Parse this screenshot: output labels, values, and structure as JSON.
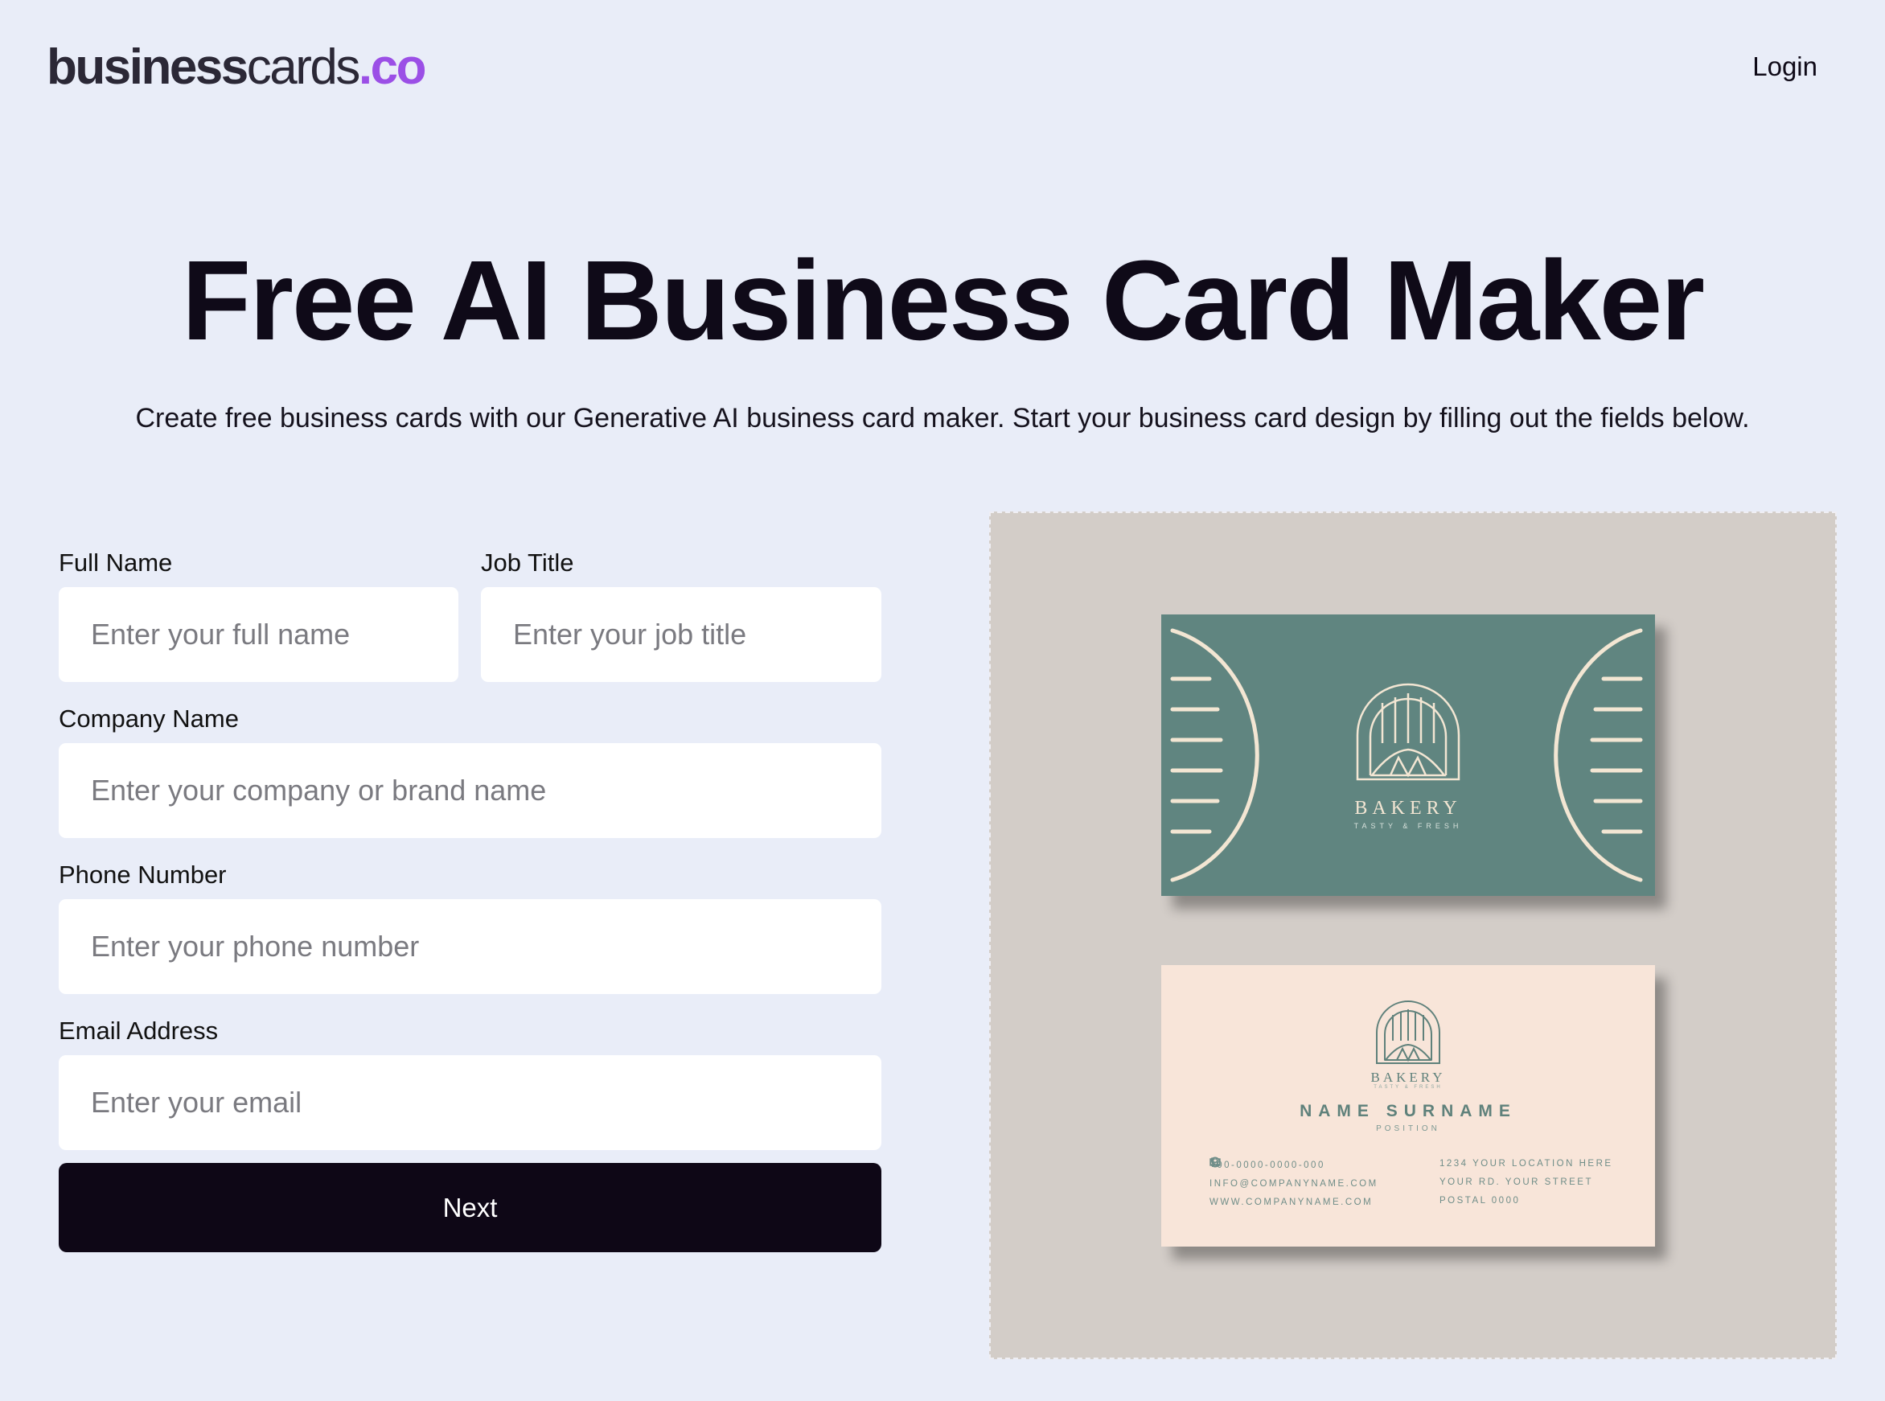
{
  "header": {
    "logo": {
      "part1": "business",
      "part2": "cards",
      "part3": ".co"
    },
    "login_label": "Login"
  },
  "hero": {
    "title": "Free AI Business Card Maker",
    "subtitle": "Create free business cards with our Generative AI business card maker. Start your business card design by filling out the fields below."
  },
  "form": {
    "full_name": {
      "label": "Full Name",
      "placeholder": "Enter your full name",
      "value": ""
    },
    "job_title": {
      "label": "Job Title",
      "placeholder": "Enter your job title",
      "value": ""
    },
    "company": {
      "label": "Company Name",
      "placeholder": "Enter your company or brand name",
      "value": ""
    },
    "phone": {
      "label": "Phone Number",
      "placeholder": "Enter your phone number",
      "value": ""
    },
    "email": {
      "label": "Email Address",
      "placeholder": "Enter your email",
      "value": ""
    },
    "next_label": "Next"
  },
  "preview": {
    "front": {
      "brand": "BAKERY",
      "tagline": "TASTY & FRESH"
    },
    "back": {
      "brand": "BAKERY",
      "tagline": "TASTY & FRESH",
      "name": "NAME SURNAME",
      "position": "POSITION",
      "phone": "+00-0000-0000-000",
      "email": "INFO@COMPANYNAME.COM",
      "website": "WWW.COMPANYNAME.COM",
      "address1": "1234 YOUR LOCATION HERE",
      "address2": "YOUR RD. YOUR STREET",
      "address3": "POSTAL 0000"
    }
  },
  "colors": {
    "background": "#e9edf8",
    "accent": "#9b4fe6",
    "button": "#0e0716",
    "card_front": "#608580",
    "card_back": "#f8e5d9",
    "preview_bg": "#d3cdc8"
  },
  "icons": [
    "phone-icon",
    "mail-icon",
    "globe-icon",
    "bakery-logo-icon"
  ]
}
